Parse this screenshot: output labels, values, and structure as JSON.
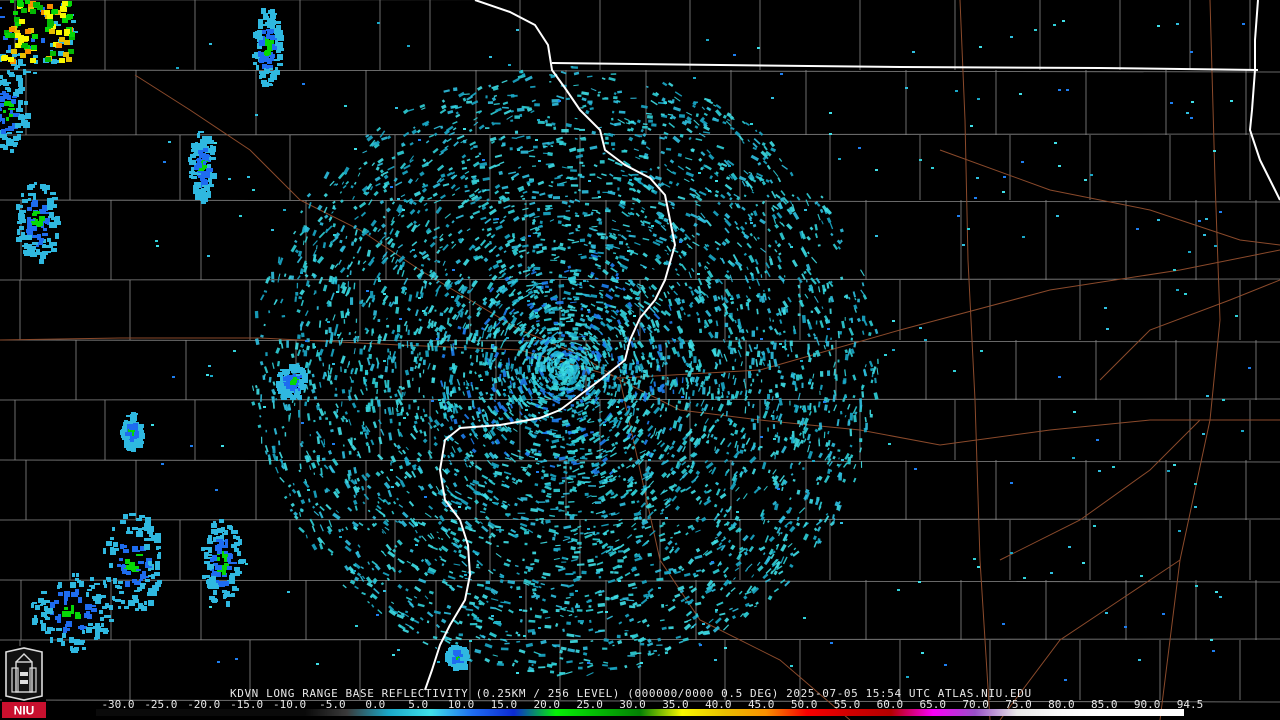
{
  "product_title": "KDVN LONG RANGE BASE REFLECTIVITY (0.25KM / 256 LEVEL) (000000/0000 0.5 DEG) 2025-07-05 15:54 UTC  ATLAS.NIU.EDU",
  "logo_text": "NIU",
  "radar_site": "KDVN",
  "timestamp": "2025-07-05 15:54 UTC",
  "scale": {
    "labels": [
      "-30.0",
      "-25.0",
      "-20.0",
      "-15.0",
      "-10.0",
      "-5.0",
      "0.0",
      "5.0",
      "10.0",
      "15.0",
      "20.0",
      "25.0",
      "30.0",
      "35.0",
      "40.0",
      "45.0",
      "50.0",
      "55.0",
      "60.0",
      "65.0",
      "70.0",
      "75.0",
      "80.0",
      "85.0",
      "90.0",
      "94.5"
    ],
    "colors": [
      "#0a0a0a",
      "#0a0a0a",
      "#0a0a0a",
      "#0a0a0a",
      "#0a0a0a",
      "#0a0a0a",
      "#3a3a3a",
      "#1aa8c8",
      "#3fe0e8",
      "#1e6cf0",
      "#0c2ad0",
      "#06f006",
      "#04b804",
      "#048004",
      "#f8f800",
      "#e8c000",
      "#f89000",
      "#f80000",
      "#d00000",
      "#b40000",
      "#f800f8",
      "#9850c8",
      "#e8e8e8",
      "#f8f8f8",
      "#ffffff",
      "#ffffff"
    ],
    "stops": [
      -30,
      -25,
      -20,
      -15,
      -10,
      -5,
      0,
      5,
      10,
      15,
      20,
      25,
      30,
      35,
      40,
      45,
      50,
      55,
      60,
      65,
      70,
      75,
      80,
      85,
      90,
      94.5
    ]
  },
  "map_colors": {
    "background": "#000000",
    "county_lines": "#8a8a8a",
    "state_lines": "#ffffff",
    "highways": "#8b4a2b",
    "clutter_primary": "#2fd0d8",
    "clutter_secondary": "#1e7ef0"
  }
}
